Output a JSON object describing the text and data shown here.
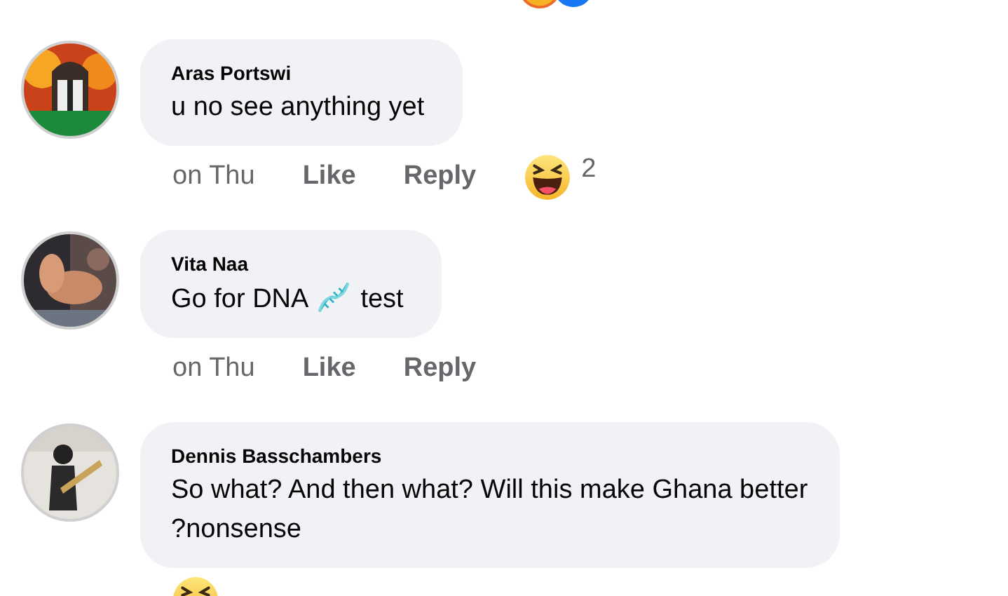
{
  "top_reactions": [
    {
      "kind": "haha"
    },
    {
      "kind": "like"
    }
  ],
  "comments": [
    {
      "author": "Aras Portswi",
      "avatar": {
        "kind": "picture"
      },
      "body": [
        {
          "kind": "text",
          "text": "u no see anything yet"
        }
      ],
      "time": "on Thu",
      "like": "Like",
      "reply": "Reply",
      "reactions": [
        {
          "kind": "haha"
        }
      ],
      "reaction_count": "2"
    },
    {
      "author": "Vita Naa",
      "avatar": {
        "kind": "picture"
      },
      "body": [
        {
          "kind": "text",
          "text": "Go for DNA"
        },
        {
          "kind": "dna"
        },
        {
          "kind": "text",
          "text": "test"
        }
      ],
      "time": "on Thu",
      "like": "Like",
      "reply": "Reply"
    },
    {
      "author": "Dennis Basschambers",
      "avatar": {
        "kind": "picture"
      },
      "body": [
        {
          "kind": "text",
          "text": "So what? And then what? Will this make Ghana better ?nonsense"
        }
      ],
      "reactions": [
        {
          "kind": "haha"
        }
      ]
    }
  ]
}
